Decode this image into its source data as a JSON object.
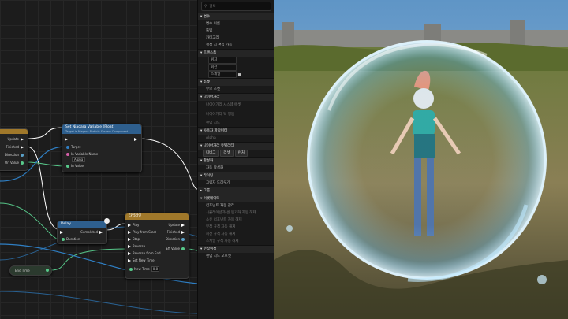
{
  "details_panel": {
    "search_placeholder": "검색",
    "sections": {
      "variable": "변수",
      "transform": "트랜스폼",
      "rendering": "소켓",
      "niagara": "나이아가라",
      "user_params": "사용자 파라미터",
      "niagara_util": "나이아가라 유틸리티",
      "activation": "활성화",
      "lod": "라이팅",
      "tags": "그룹",
      "asset_user_data": "어셋데이터",
      "physics": "무작위성"
    },
    "rows": {
      "var_name": "변수 이름",
      "tooltip": "툴팁",
      "category": "카테고리",
      "instance_editable": "생성 시 편집 가능",
      "location": "위치",
      "rotation": "회전",
      "scale": "스케일",
      "parent_socket": "부모 소켓",
      "niagara_system_asset": "나이아가라 시스템 에셋",
      "niagara_tick_behavior": "나이아가라 틱 행동",
      "seed": "랜덤 시드",
      "alpha": "Alpha",
      "auto_activate": "자동 활성화",
      "cast_shadow": "그림자 드리우기",
      "group": "그룹",
      "auto_manage": "컴포넌트 자동 관리",
      "u1": "시뮬레이션과 씬 동기화 자동 해제",
      "u2": "소유 컴포넌트 자동 해제",
      "u3": "부착 규칙 자동 해제",
      "u4": "회전 규칙 자동 해제",
      "u5": "스케일 규칙 자동 해제",
      "random_seed_offset": "랜덤 시드 오프셋"
    },
    "buttons": [
      "디버그",
      "리셋",
      "런처"
    ]
  },
  "nodes": {
    "set_var": {
      "title": "Set Niagara Variable (Float)",
      "subtitle": "Target is Niagara Particle System Component",
      "target": "Target",
      "in_variable_name": "In Variable Name",
      "variable_value": "Alpha",
      "in_value": "In Value"
    },
    "left_partial": {
      "update": "Update",
      "finished": "Finished",
      "direction": "Direction",
      "value": "On Value"
    },
    "delay": {
      "title": "Delay",
      "completed": "Completed",
      "duration": "Duration"
    },
    "timeline": {
      "title": "타임라인",
      "inputs": [
        "Play",
        "Play from Start",
        "Stop",
        "Reverse",
        "Reverse from End",
        "Set New Time"
      ],
      "outputs": [
        "Update",
        "Finished",
        "Direction",
        "Eff Value"
      ],
      "new_time_label": "New Time",
      "new_time_value": "0.0"
    },
    "end_time": {
      "label": "End Time"
    }
  },
  "colors": {
    "exec_wire": "#ffffff",
    "float_wire": "#57c98a",
    "object_wire": "#2f7fc4",
    "function_header": "#2e5f8e",
    "timeline_header": "#a0782a"
  }
}
